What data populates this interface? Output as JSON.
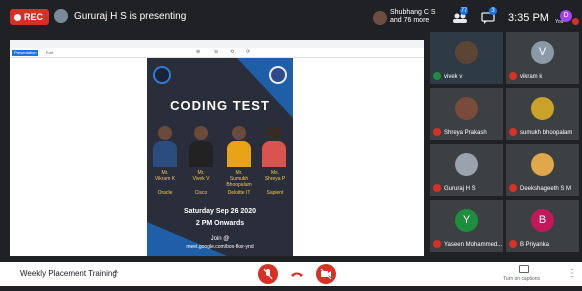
{
  "top": {
    "rec_label": "REC",
    "presenting_text": "Gururaj H S is presenting",
    "people_line1": "Shubhang C S",
    "people_line2": "and 76 more",
    "participants_count": "77",
    "chat_badge": "3",
    "time": "3:35 PM",
    "you_label": "You",
    "user_initial": "D"
  },
  "share": {
    "tab_label": "Presentation",
    "toolbar_item": "Edit",
    "tool_labels": [
      "⊕",
      "⊖",
      "⟲",
      "⟳"
    ]
  },
  "poster": {
    "title": "CODING TEST",
    "speakers": [
      {
        "name_line1": "Mr.",
        "name_line2": "Vikram K",
        "org": "Oracle"
      },
      {
        "name_line1": "Mr.",
        "name_line2": "Vivek V",
        "org": "Cisco"
      },
      {
        "name_line1": "Mr.",
        "name_line2": "Sumukh Bhoopalam",
        "org": "Deloitte IT"
      },
      {
        "name_line1": "Ms.",
        "name_line2": "Shreya P",
        "org": "Sapient"
      }
    ],
    "date": "Saturday Sep 26 2020",
    "time": "2 PM Onwards",
    "join_label": "Join @",
    "link": "meet.google.com/box-fkxr-ynd"
  },
  "participants": [
    {
      "name": "vivek v",
      "initial": ""
    },
    {
      "name": "vikram k",
      "initial": "V"
    },
    {
      "name": "Shreya Prakash",
      "initial": ""
    },
    {
      "name": "sumukh bhoopalam",
      "initial": ""
    },
    {
      "name": "Gururaj H S",
      "initial": ""
    },
    {
      "name": "Deekshageeth S M",
      "initial": ""
    },
    {
      "name": "Yaseen Mohammed...",
      "initial": "Y"
    },
    {
      "name": "B Priyanka",
      "initial": "B"
    }
  ],
  "bottom": {
    "meeting_name": "Weekly Placement Training",
    "captions_label": "Turn on captions"
  },
  "colors": {
    "red": "#d93025",
    "tile_bg": "#3c4043",
    "accent": "#1a73e8",
    "avatar_green": "#1e8e3e",
    "avatar_pink": "#c2185b"
  }
}
